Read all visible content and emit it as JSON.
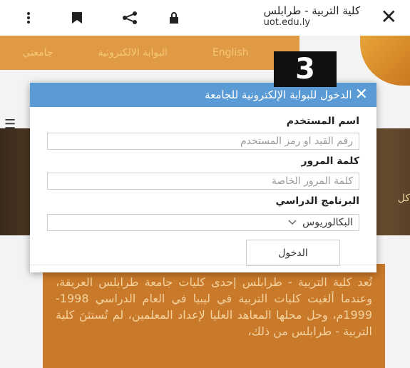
{
  "browser": {
    "title": "كلية التربية - طرابلس",
    "url": "uot.edu.ly",
    "icons": [
      "more-vert-icon",
      "bookmark-icon",
      "share-icon",
      "lock-icon",
      "close-icon"
    ]
  },
  "site_nav": {
    "items": [
      "English",
      "البوابة الالكترونية",
      "جامعتي"
    ]
  },
  "overlay": {
    "badge_number": "3"
  },
  "modal": {
    "title": "الدخول للبوابة الإلكترونية للجامعة",
    "username_label": "اسم المستخدم",
    "username_placeholder": "رقم القيد او رمز المستخدم",
    "password_label": "كلمة المرور",
    "password_placeholder": "كلمة المرور الخاصة",
    "program_label": "البرنامج الدراسي",
    "program_selected": "البكالوريوس",
    "submit_label": "الدخول"
  },
  "background": {
    "side_fragment": "كل",
    "paragraph": "تُعد كلية التربية - طرابلس إحدى كليات جامعة طرابلس العريقة، وعندما ألغيت كليات التربية في ليبيا في العام الدراسي 1998-1999م، وحل محلها المعاهد العليا لإعداد المعلمين، لم تُستثنَ كلية التربية - طرابلس من ذلك،"
  },
  "colors": {
    "accent": "#5b9bd5",
    "brand_orange": "#e09a43",
    "panel_orange": "#c9792a"
  }
}
